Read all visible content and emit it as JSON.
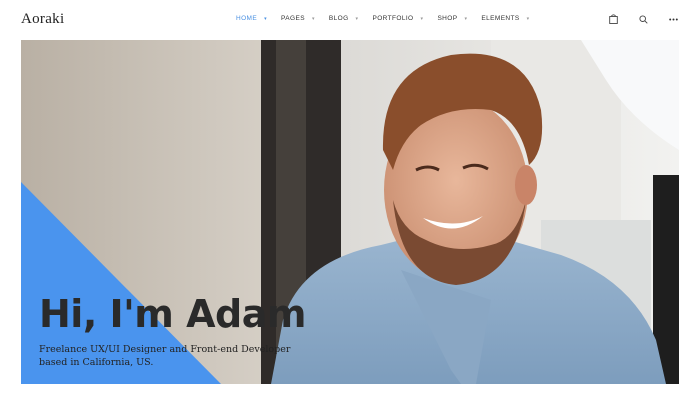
{
  "header": {
    "logo": "Aoraki",
    "nav": [
      {
        "label": "HOME",
        "active": true
      },
      {
        "label": "PAGES",
        "active": false
      },
      {
        "label": "BLOG",
        "active": false
      },
      {
        "label": "PORTFOLIO",
        "active": false
      },
      {
        "label": "SHOP",
        "active": false
      },
      {
        "label": "ELEMENTS",
        "active": false
      }
    ],
    "icons": [
      "shopping-bag-icon",
      "search-icon",
      "more-dots-icon"
    ],
    "accent_color": "#4a90e2"
  },
  "hero": {
    "title": "Hi, I'm Adam",
    "subtitle_line1": "Freelance UX/UI Designer and Front-end Developer",
    "subtitle_line2": "based in California, US.",
    "triangle_color": "#4a94ee"
  }
}
